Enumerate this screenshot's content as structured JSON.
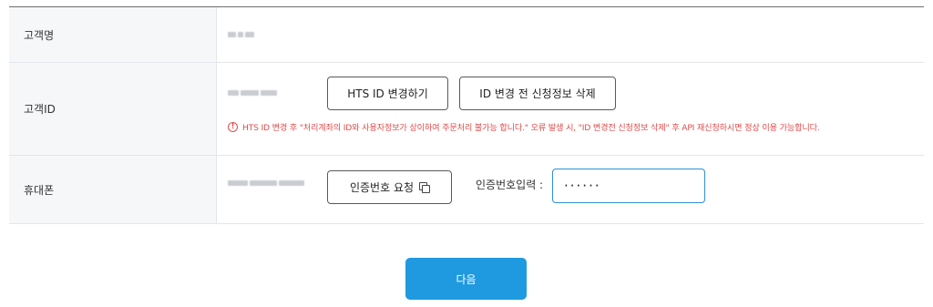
{
  "form": {
    "customer_name": {
      "label": "고객명"
    },
    "customer_id": {
      "label": "고객ID",
      "change_button": "HTS ID 변경하기",
      "delete_button": "ID 변경 전 신청정보 삭제",
      "warning_icon": "!",
      "warning": "HTS ID 변경 후 \"처리계좌의 ID와 사용자정보가 상이하여 주문처리 불가능 합니다.\" 오류 발생 시, \"ID 변경전 신청정보 삭제\" 후 API 재신청하시면 정상 이용 가능합니다."
    },
    "phone": {
      "label": "휴대폰",
      "request_button": "인증번호 요청",
      "code_label": "인증번호입력 :",
      "code_value": "······"
    }
  },
  "next_button": "다음",
  "colors": {
    "primary": "#1f9ae0",
    "warning": "#e14b4b",
    "label_bg": "#f6f7f9"
  },
  "icons": {
    "warning": "exclamation-circle-icon",
    "copy": "copy-icon"
  }
}
